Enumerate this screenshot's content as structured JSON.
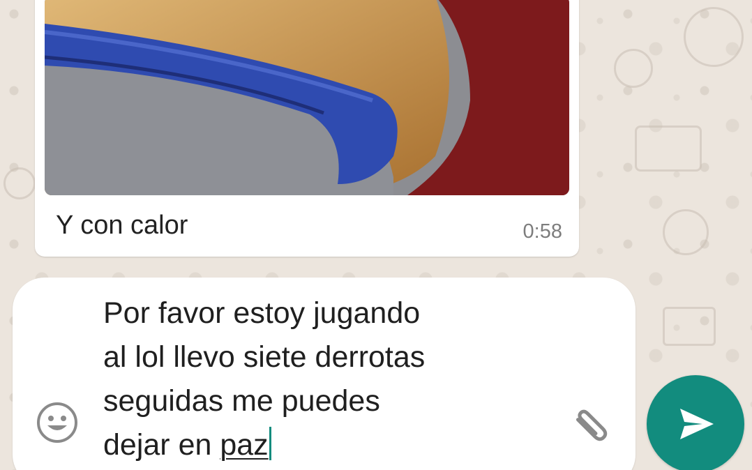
{
  "chat": {
    "incoming_message": {
      "caption": "Y con calor",
      "time": "0:58"
    }
  },
  "composer": {
    "lines": [
      "Por favor estoy jugando",
      "al lol llevo siete derrotas",
      "seguidas me puedes",
      "dejar en "
    ],
    "underlined_word": "paz"
  },
  "icons": {
    "emoji": "emoji-icon",
    "attach": "paperclip-icon",
    "send": "send-icon"
  },
  "colors": {
    "wallpaper": "#ECE5DD",
    "accent": "#128C7E",
    "bubble": "#FFFFFF"
  }
}
